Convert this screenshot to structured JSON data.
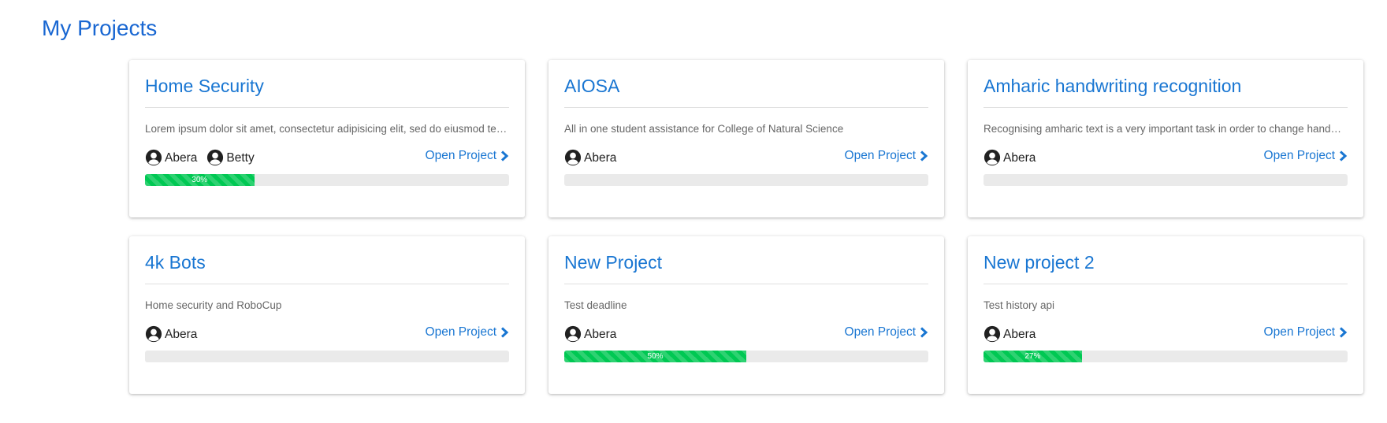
{
  "page": {
    "title": "My Projects"
  },
  "colors": {
    "accent": "#1976d2",
    "progress": "#00c853",
    "track": "#eaeaea"
  },
  "projects": [
    {
      "title": "Home Security",
      "description": "Lorem ipsum dolor sit amet, consectetur adipisicing elit, sed do eiusmod tempor incididunt ut labore et dolore magna aliqua.",
      "members": [
        "Abera",
        "Betty"
      ],
      "link_label": "Open Project",
      "progress": 30,
      "progress_label": "30%"
    },
    {
      "title": "AIOSA",
      "description": "All in one student assistance for College of Natural Science",
      "members": [
        "Abera"
      ],
      "link_label": "Open Project",
      "progress": 0,
      "progress_label": ""
    },
    {
      "title": "Amharic handwriting recognition",
      "description": "Recognising amharic text is a very important task in order to change handwritten documents into digital text.",
      "members": [
        "Abera"
      ],
      "link_label": "Open Project",
      "progress": 0,
      "progress_label": ""
    },
    {
      "title": "4k Bots",
      "description": "Home security and RoboCup",
      "members": [
        "Abera"
      ],
      "link_label": "Open Project",
      "progress": 0,
      "progress_label": ""
    },
    {
      "title": "New Project",
      "description": "Test deadline",
      "members": [
        "Abera"
      ],
      "link_label": "Open Project",
      "progress": 50,
      "progress_label": "50%"
    },
    {
      "title": "New project 2",
      "description": "Test history api",
      "members": [
        "Abera"
      ],
      "link_label": "Open Project",
      "progress": 27,
      "progress_label": "27%"
    }
  ]
}
